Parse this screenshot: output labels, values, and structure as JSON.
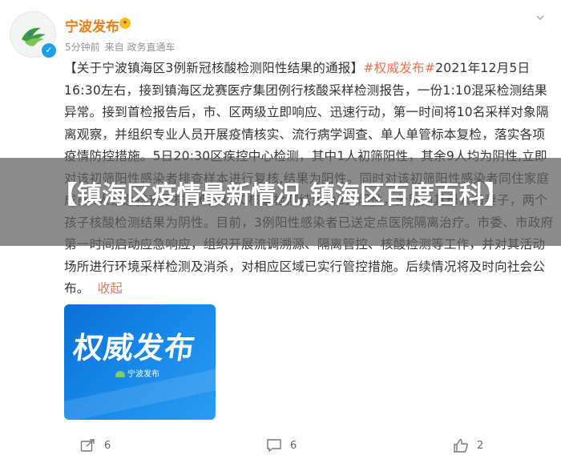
{
  "post": {
    "username": "宁波发布",
    "badge_glyph": "✦",
    "verified_glyph": "✓",
    "time": "5分钟前",
    "source": "来自 政务直通车",
    "content": {
      "bracket_title": "【关于宁波镇海区3例新冠核酸检测阳性结果的通报】",
      "hashtag": "#权威发布#",
      "body": "2021年12月5日16:30左右，接到镇海区龙赛医疗集团例行核酸采样检测报告，一份1:10混采检测结果异常。接到首检报告后，市、区两级立即响应、迅速行动，第一时间将10名采样对象隔离观察，并组织专业人员开展疫情核实、流行病学调查、单人单管标本复检，落实各项疫情防控措施。5日20:30区疾控中心检测，其中1人初筛阳性，其余9人均为阴性,立即对该初筛阳性感染者排查样本进行复核,结果为阳性。同时对该初筛阳性感染者同住家庭成员4人紧急排查采样，6日4:00核酸检测结果为2人阳性，分别为其母亲和妻子，两个孩子核酸检测结果为阴性。目前，3例阳性感染者已送定点医院隔离治疗。市委、市政府第一时间启动应急响应，组织开展流调溯源、隔离管控、核酸检测等工作，并对其活动场所进行环境采样检测及消杀，对相应区域已实行管控措施。后续情况将及时向社会公布。",
      "collapse_label": "收起"
    },
    "image_card": {
      "title": "权威发布",
      "logo_text": "宁波发布"
    }
  },
  "overlay": {
    "title": "【镇海区疫情最新情况,镇海区百度百科】"
  },
  "actions": {
    "share_count": "6",
    "comment_count": "6",
    "like_count": "2"
  },
  "colors": {
    "username": "#f07c13",
    "hashtag": "#eb7350",
    "card_blue": "#1686e8",
    "overlay_bg": "#5f5f5f"
  }
}
